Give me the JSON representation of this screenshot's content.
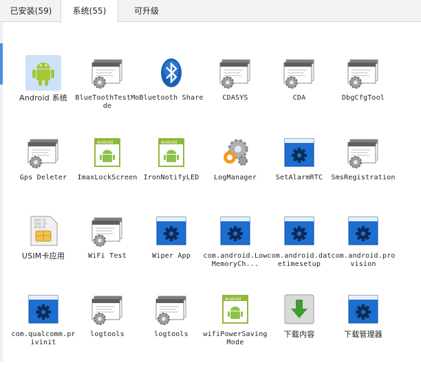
{
  "tabs": [
    {
      "label": "已安装(59)",
      "active": false
    },
    {
      "label": "系统(55)",
      "active": true
    },
    {
      "label": "可升级",
      "active": false
    }
  ],
  "apps": [
    {
      "label": "Android 系统",
      "icon": "android-robot-icon",
      "selected": true
    },
    {
      "label": "BlueToothTestMode",
      "icon": "window-gear-icon"
    },
    {
      "label": "Bluetooth Share",
      "icon": "bluetooth-icon"
    },
    {
      "label": "CDASYS",
      "icon": "window-gear-icon"
    },
    {
      "label": "CDA",
      "icon": "window-gear-icon"
    },
    {
      "label": "DbgCfgTool",
      "icon": "window-gear-icon"
    },
    {
      "label": "Gps Deleter",
      "icon": "window-gear-icon"
    },
    {
      "label": "ImaxLockScreen",
      "icon": "android-card-icon"
    },
    {
      "label": "IronNotifyLED",
      "icon": "android-card-icon"
    },
    {
      "label": "LogManager",
      "icon": "log-gear-icon"
    },
    {
      "label": "SetAlarmRTC",
      "icon": "blue-settings-icon"
    },
    {
      "label": "SmsRegistration",
      "icon": "window-gear-icon"
    },
    {
      "label": "USIM卡应用",
      "icon": "sim-card-icon"
    },
    {
      "label": "WiFi Test",
      "icon": "window-gear-icon"
    },
    {
      "label": "Wiper App",
      "icon": "blue-settings-icon"
    },
    {
      "label": "com.android.LowMemoryCh...",
      "icon": "blue-settings-icon"
    },
    {
      "label": "com.android.datetimesetup",
      "icon": "blue-settings-icon"
    },
    {
      "label": "com.android.provision",
      "icon": "blue-settings-icon"
    },
    {
      "label": "com.qualcomm.privinit",
      "icon": "blue-settings-icon"
    },
    {
      "label": "logtools",
      "icon": "window-gear-icon"
    },
    {
      "label": "logtools",
      "icon": "window-gear-icon"
    },
    {
      "label": "wifiPowerSavingMode",
      "icon": "android-card-icon"
    },
    {
      "label": "下载内容",
      "icon": "download-arrow-icon"
    },
    {
      "label": "下载管理器",
      "icon": "blue-settings-icon"
    }
  ],
  "colors": {
    "accent": "#4a90e2",
    "settings_blue": "#1c6fd1",
    "android_green": "#8bc34a"
  }
}
